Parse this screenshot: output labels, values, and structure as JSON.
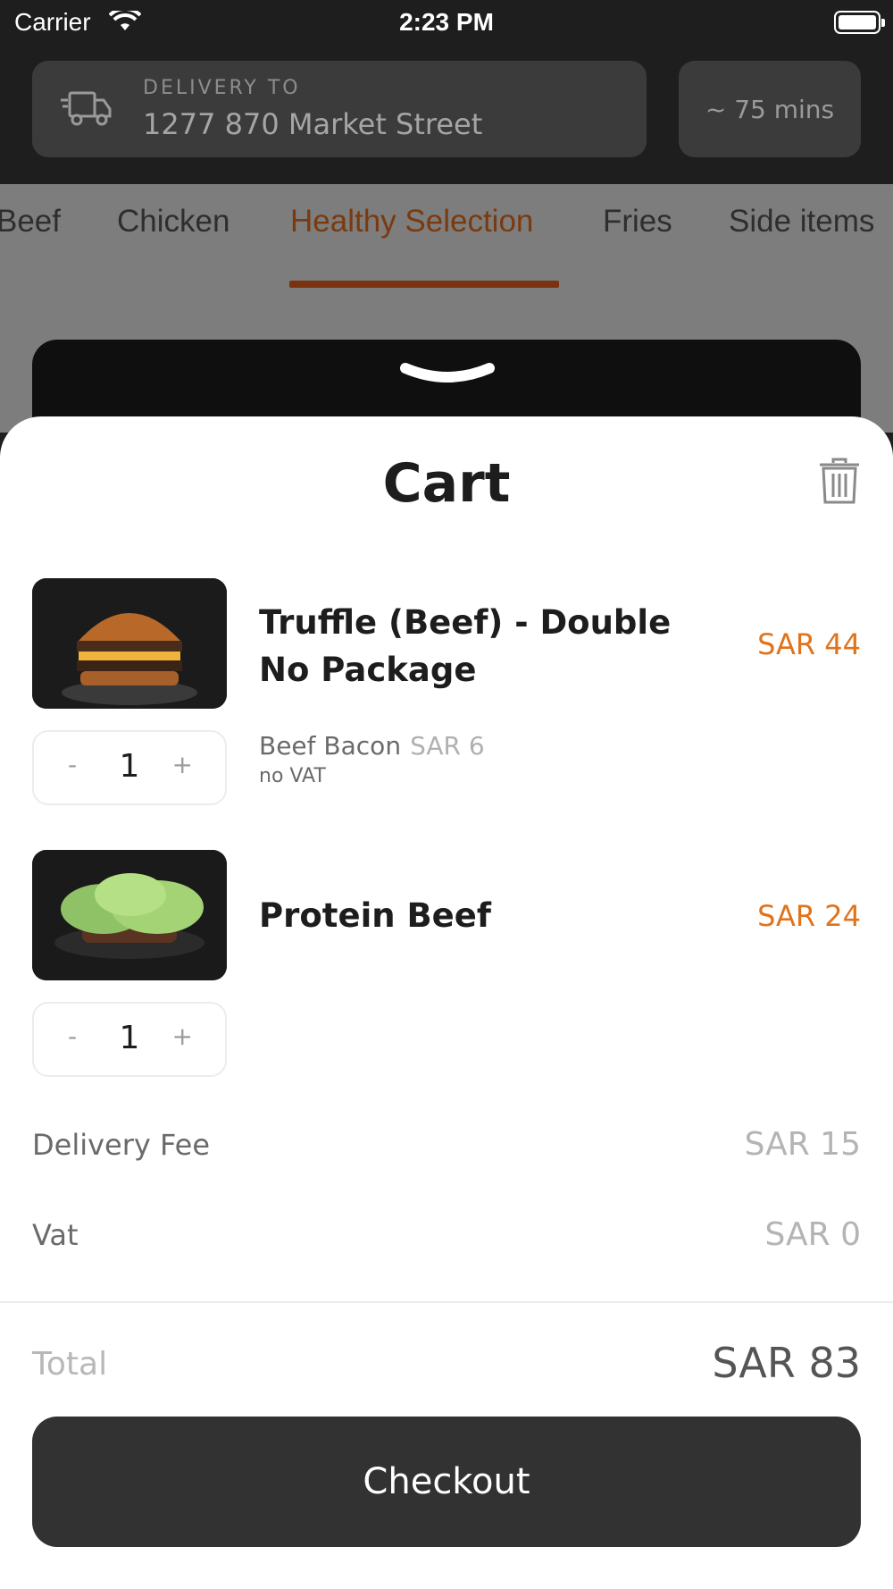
{
  "status_bar": {
    "carrier": "Carrier",
    "time": "2:23 PM"
  },
  "header": {
    "delivery_label": "DELIVERY TO",
    "address": "1277 870 Market Street",
    "eta": "~ 75 mins"
  },
  "tabs": [
    "Beef",
    "Chicken",
    "Healthy Selection",
    "Fries",
    "Side items"
  ],
  "active_tab": "Healthy Selection",
  "cart": {
    "title": "Cart",
    "items": [
      {
        "name_line1": "Truffle (Beef) - Double",
        "name_line2": "No Package",
        "price": "SAR 44",
        "quantity": "1",
        "addon_name": "Beef Bacon",
        "addon_price": "SAR 6",
        "addon_note": "no VAT"
      },
      {
        "name_line1": "Protein Beef",
        "price": "SAR 24",
        "quantity": "1"
      }
    ],
    "stepper": {
      "minus": "-",
      "plus": "+"
    },
    "delivery_fee_label": "Delivery Fee",
    "delivery_fee": "SAR 15",
    "vat_label": "Vat",
    "vat": "SAR 0",
    "total_label": "Total",
    "total": "SAR 83",
    "checkout_label": "Checkout"
  },
  "colors": {
    "accent": "#e1731b",
    "button": "#323232"
  }
}
